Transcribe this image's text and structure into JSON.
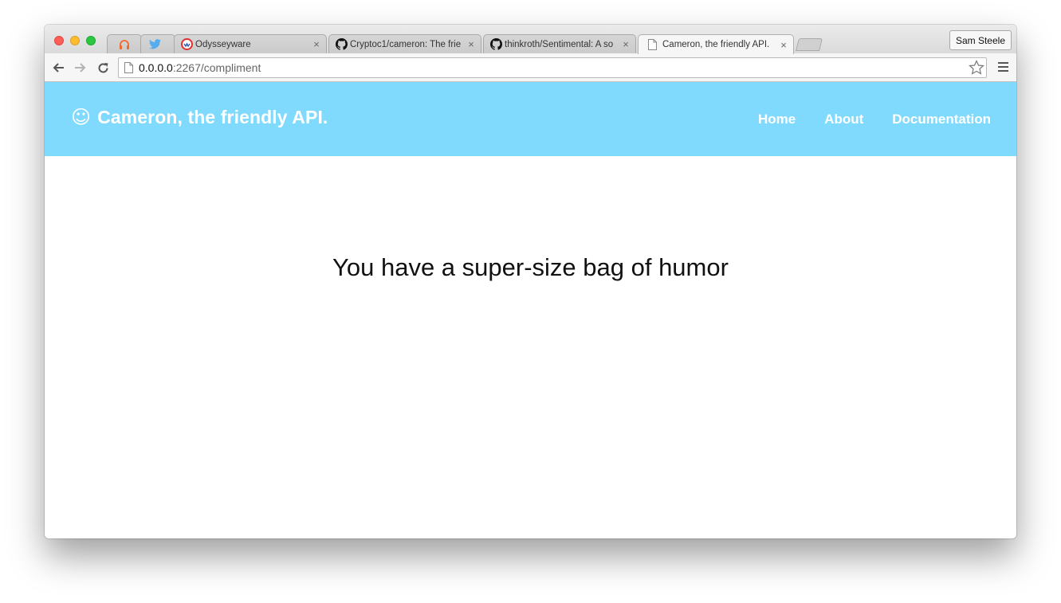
{
  "browser": {
    "profile_name": "Sam Steele",
    "tabs": [
      {
        "title": "",
        "icon": "headphones-icon",
        "icon_color": "#f06a2e"
      },
      {
        "title": "",
        "icon": "twitter-icon",
        "icon_color": "#55acee"
      },
      {
        "title": "Odysseyware",
        "icon": "odysseyware-icon",
        "icon_color": "#e0312f"
      },
      {
        "title": "Cryptoc1/cameron: The frie",
        "icon": "github-icon",
        "icon_color": "#111111"
      },
      {
        "title": "thinkroth/Sentimental: A so",
        "icon": "github-icon",
        "icon_color": "#111111"
      },
      {
        "title": "Cameron, the friendly API.",
        "icon": "page-icon",
        "icon_color": "#888888",
        "active": true
      }
    ],
    "close_glyph": "×",
    "address": {
      "host": "0.0.0.0",
      "path": ":2267/compliment"
    }
  },
  "site": {
    "brand_icon": "☺",
    "brand_name": "Cameron, the friendly API.",
    "nav": [
      "Home",
      "About",
      "Documentation"
    ],
    "accent_color": "#80dafe"
  },
  "main": {
    "compliment": "You have a super-size bag of humor"
  }
}
